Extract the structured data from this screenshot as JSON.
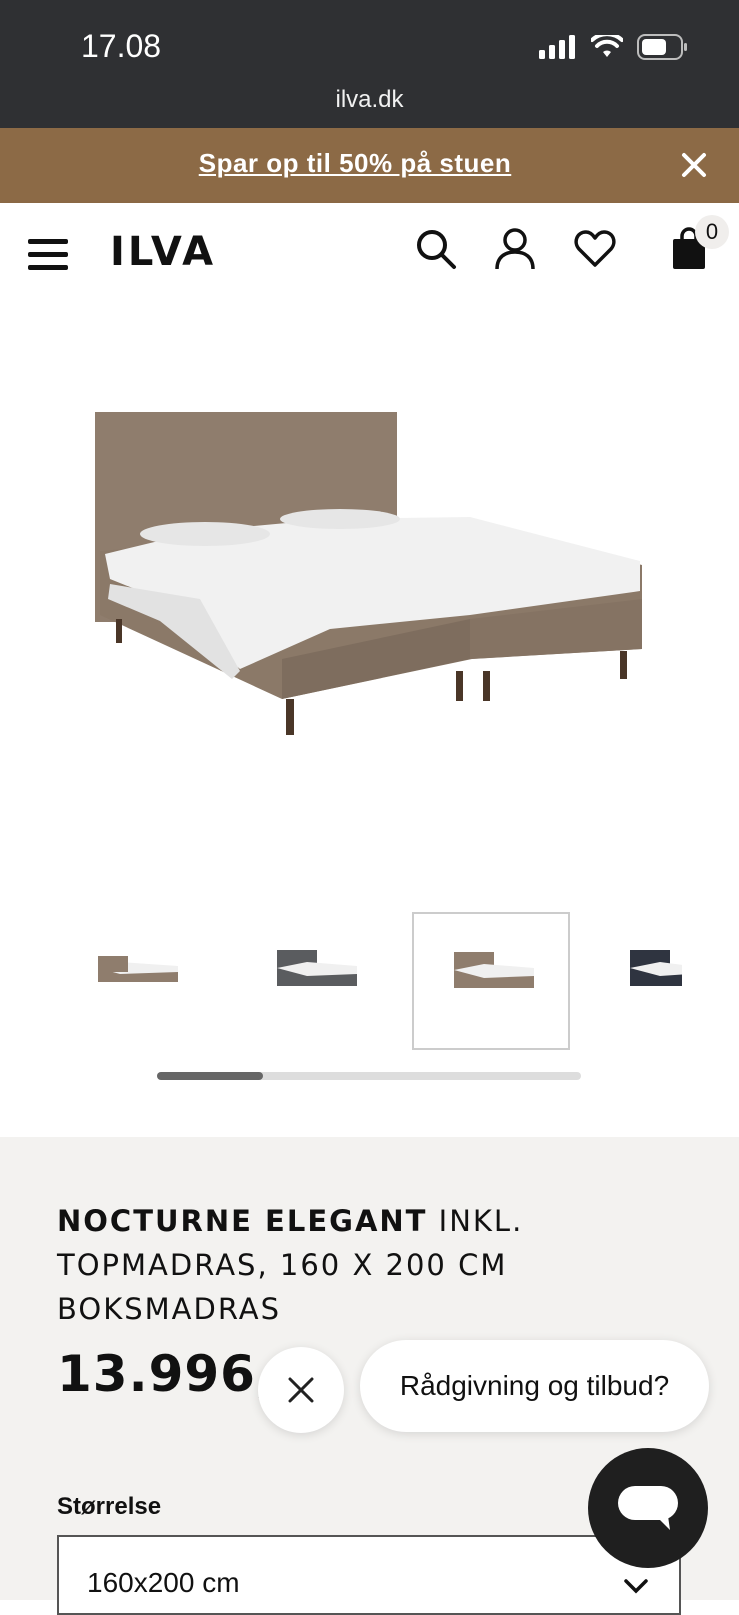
{
  "status_bar": {
    "time": "17.08",
    "url": "ilva.dk"
  },
  "promo": {
    "text": "Spar op til 50% på stuen"
  },
  "header": {
    "logo": "ILVA",
    "cart_count": "0"
  },
  "product": {
    "title_bold": "NOCTURNE ELEGANT",
    "title_rest": " INKL. TOPMADRAS, 160 X 200 CM BOKSMADRAS",
    "price": "13.996,-",
    "size_label": "Størrelse",
    "size_value": "160x200 cm"
  },
  "gallery": {
    "thumbnail_colors": [
      "#8f7d6d",
      "#5a5c5f",
      "#8f7d6d",
      "#2f3440"
    ],
    "active_index": 2,
    "scroll_fraction": 0.25
  },
  "chat": {
    "prompt": "Rådgivning og tilbud?"
  }
}
